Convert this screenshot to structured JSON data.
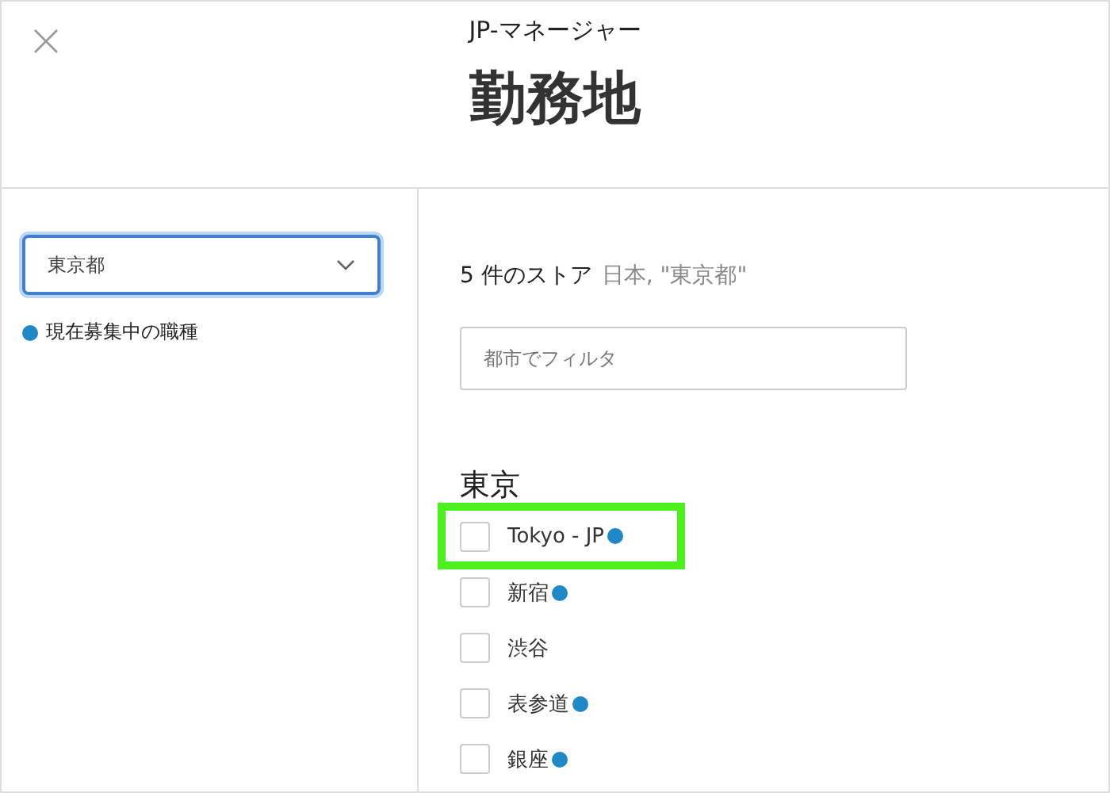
{
  "header": {
    "subtitle": "JP-マネージャー",
    "title": "勤務地"
  },
  "sidebar": {
    "select": {
      "value": "東京都"
    },
    "legend": "現在募集中の職種"
  },
  "results": {
    "count": "5 件のストア",
    "location": "日本, \"東京都\"",
    "filter": {
      "placeholder": "都市でフィルタ"
    },
    "group": "東京",
    "stores": [
      {
        "name": "Tokyo - JP",
        "checked": false,
        "hiring": true,
        "highlighted": true
      },
      {
        "name": "新宿",
        "checked": false,
        "hiring": true,
        "highlighted": false
      },
      {
        "name": "渋谷",
        "checked": false,
        "hiring": false,
        "highlighted": false
      },
      {
        "name": "表参道",
        "checked": false,
        "hiring": true,
        "highlighted": false
      },
      {
        "name": "銀座",
        "checked": false,
        "hiring": true,
        "highlighted": false
      }
    ]
  }
}
